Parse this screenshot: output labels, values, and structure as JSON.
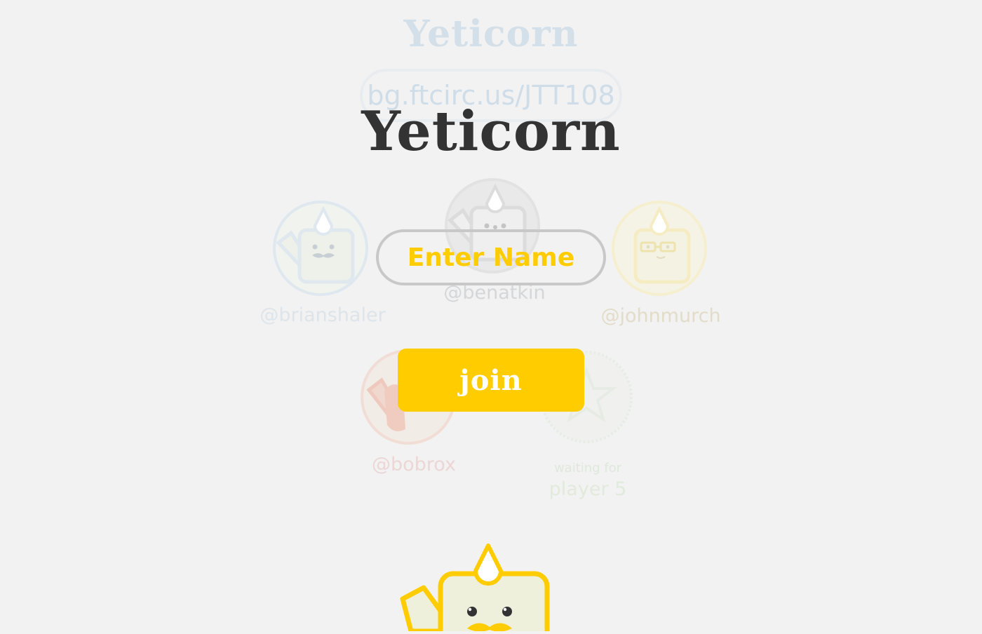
{
  "background": {
    "title": "Yeticorn",
    "game_url": "bg.ftcirc.us/JTT108",
    "players": [
      {
        "handle": "@brianshaler",
        "color": "#c7d8e6"
      },
      {
        "handle": "@benatkin",
        "color": "#cccccc"
      },
      {
        "handle": "@johnmurch",
        "color": "#f3e7b3"
      },
      {
        "handle": "@bobrox",
        "color": "#efc0b3"
      }
    ],
    "waiting": {
      "label": "waiting for",
      "player": "player 5",
      "color": "#dfe8dc"
    }
  },
  "join_form": {
    "title": "Yeticorn",
    "name_placeholder": "Enter Name",
    "join_label": "join"
  },
  "colors": {
    "accent": "#ffcc00",
    "background": "#f2f2f2",
    "title": "#333333"
  },
  "icons": {
    "avatar": "yeticorn-avatar-icon",
    "mascot": "yeticorn-mascot-icon",
    "star": "star-badge-icon"
  }
}
